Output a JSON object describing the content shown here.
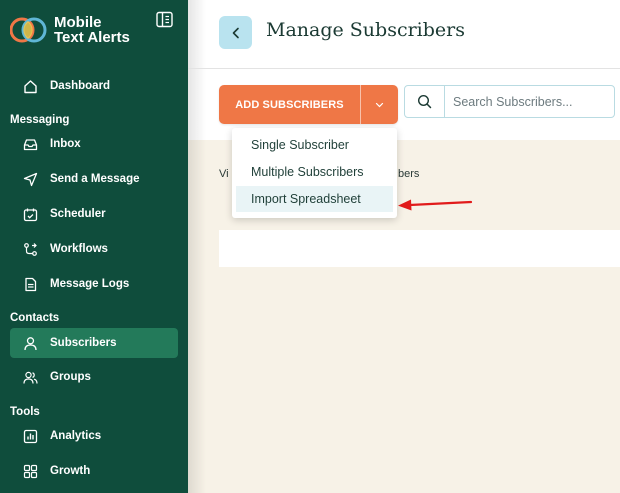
{
  "app": {
    "name_line1": "Mobile",
    "name_line2": "Text Alerts"
  },
  "sidebar": {
    "sections": {
      "messaging": "Messaging",
      "contacts": "Contacts",
      "tools": "Tools"
    },
    "items": [
      {
        "label": "Dashboard",
        "icon": "home-icon"
      },
      {
        "label": "Inbox",
        "icon": "inbox-icon"
      },
      {
        "label": "Send a Message",
        "icon": "send-icon"
      },
      {
        "label": "Scheduler",
        "icon": "calendar-icon"
      },
      {
        "label": "Workflows",
        "icon": "workflow-icon"
      },
      {
        "label": "Message Logs",
        "icon": "logs-icon"
      },
      {
        "label": "Subscribers",
        "icon": "user-icon",
        "active": true
      },
      {
        "label": "Groups",
        "icon": "groups-icon"
      },
      {
        "label": "Analytics",
        "icon": "analytics-icon"
      },
      {
        "label": "Growth",
        "icon": "growth-icon"
      }
    ]
  },
  "header": {
    "title": "Manage Subscribers"
  },
  "toolbar": {
    "add_label": "ADD SUBSCRIBERS",
    "search_placeholder": "Search Subscribers..."
  },
  "dropdown": {
    "items": [
      "Single Subscriber",
      "Multiple Subscribers",
      "Import Spreadsheet"
    ],
    "highlighted_index": 2
  },
  "content": {
    "view_prefix": "Vi",
    "view_suffix": "bers"
  },
  "colors": {
    "sidebar_bg": "#0f4d3c",
    "active_item": "#237a5a",
    "accent_orange": "#ef7746",
    "content_bg": "#f7f2e7",
    "annotation_arrow": "#e11b1b"
  }
}
